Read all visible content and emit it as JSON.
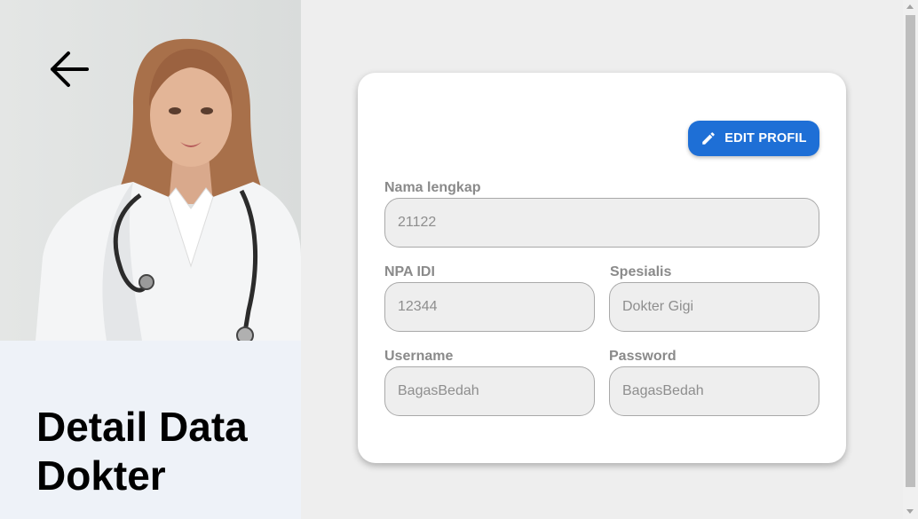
{
  "page": {
    "title": "Detail Data Dokter",
    "back_icon": "arrow-left-icon"
  },
  "profile": {
    "edit_button_label": "EDIT PROFIL",
    "edit_icon": "pencil-icon"
  },
  "fields": {
    "full_name": {
      "label": "Nama lengkap",
      "placeholder": "21122"
    },
    "npa_idi": {
      "label": "NPA IDI",
      "placeholder": "12344"
    },
    "specialist": {
      "label": "Spesialis",
      "placeholder": "Dokter Gigi"
    },
    "username": {
      "label": "Username",
      "placeholder": "BagasBedah"
    },
    "password": {
      "label": "Password",
      "placeholder": "BagasBedah"
    }
  },
  "colors": {
    "accent": "#1e6fd6",
    "left_panel_bg": "#eef2f8",
    "page_bg": "#eeeeee"
  }
}
